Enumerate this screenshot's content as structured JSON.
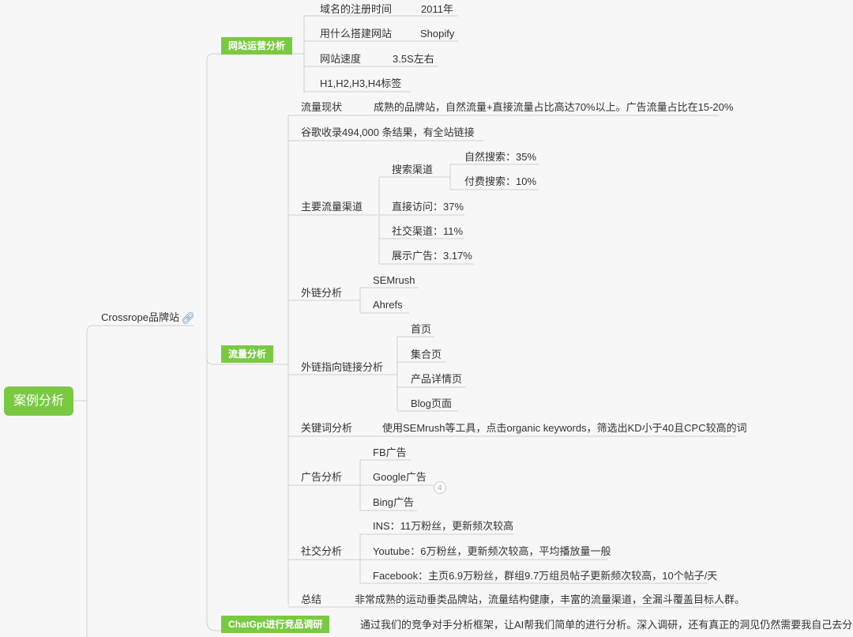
{
  "root": "案例分析",
  "site": "Crossrope品牌站",
  "ops": {
    "tag": "网站运营分析",
    "domain_label": "域名的注册时间",
    "domain_value": "2011年",
    "platform_label": "用什么搭建网站",
    "platform_value": "Shopify",
    "speed_label": "网站速度",
    "speed_value": "3.5S左右",
    "headings": "H1,H2,H3,H4标签"
  },
  "traffic": {
    "tag": "流量分析",
    "status_label": "流量现状",
    "status_value": "成熟的品牌站，自然流量+直接流量占比高达70%以上。广告流量占比在15-20%",
    "google_index": "谷歌收录494,000 条结果，有全站链接",
    "channels": {
      "label": "主要流量渠道",
      "search": "搜索渠道",
      "organic": "自然搜索：35%",
      "paid": "付费搜索：10%",
      "direct": "直接访问：37%",
      "social": "社交渠道：11%",
      "display": "展示广告：3.17%"
    },
    "backlinks": {
      "label": "外链分析",
      "tool1": "SEMrush",
      "tool2": "Ahrefs"
    },
    "backlink_targets": {
      "label": "外链指向链接分析",
      "home": "首页",
      "collection": "集合页",
      "product": "产品详情页",
      "blog": "Blog页面"
    },
    "keywords": {
      "label": "关键词分析",
      "value": "使用SEMrush等工具，点击organic keywords，筛选出KD小于40且CPC较高的词"
    },
    "ads": {
      "label": "广告分析",
      "fb": "FB广告",
      "google": "Google广告",
      "bing": "Bing广告",
      "badge": "4"
    },
    "social": {
      "label": "社交分析",
      "ins": "INS：11万粉丝，更新频次较高",
      "youtube": "Youtube：6万粉丝，更新频次较高，平均播放量一般",
      "facebook": "Facebook：主页6.9万粉丝，群组9.7万组员帖子更新频次较高，10个帖子/天"
    },
    "summary_label": "总结",
    "summary_value": "非常成熟的运动垂类品牌站，流量结构健康，丰富的流量渠道，全漏斗覆盖目标人群。"
  },
  "chatgpt": {
    "tag": "ChatGpt进行竞品调研",
    "value": "通过我们的竞争对手分析框架，让AI帮我们简单的进行分析。深入调研，还有真正的洞见仍然需要我自己去分析调研。"
  },
  "colors": {
    "tag_green": "#7ac943",
    "line": "#cfcfcf"
  },
  "icons": {
    "link": "link-icon"
  }
}
